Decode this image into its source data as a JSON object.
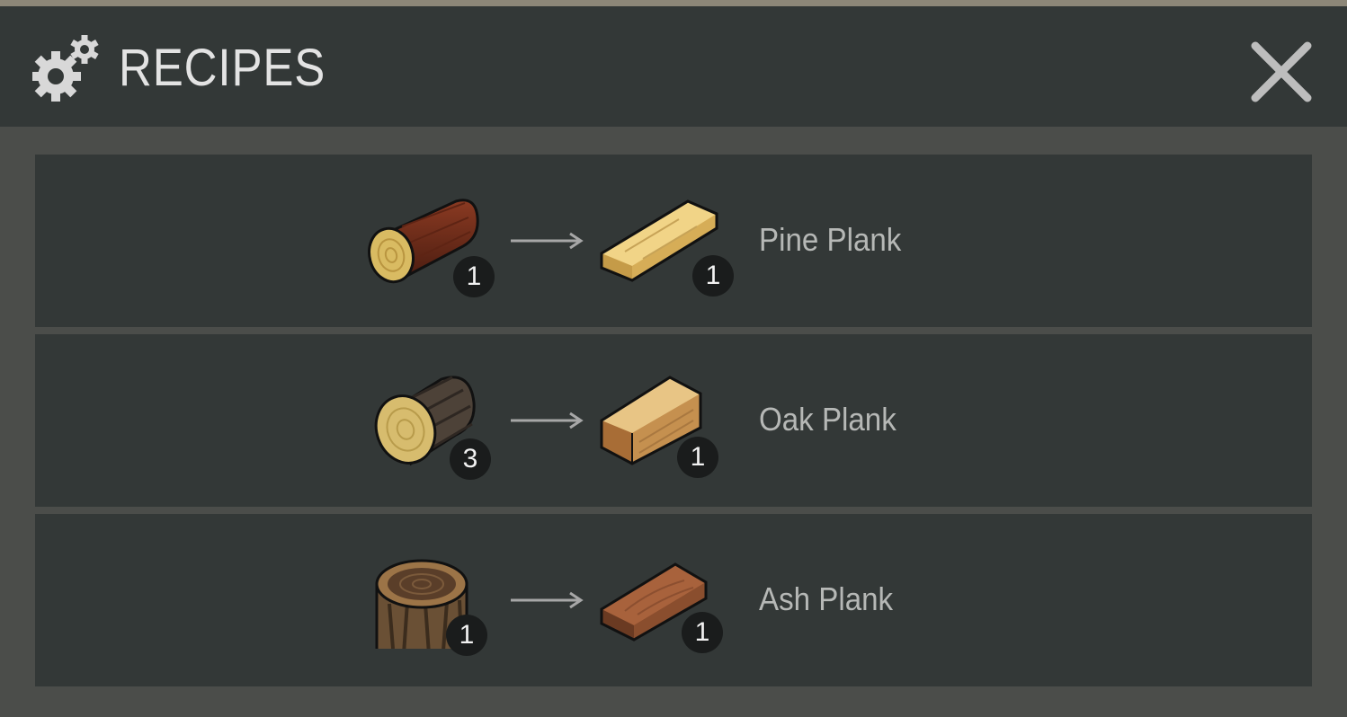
{
  "header": {
    "title": "RECIPES",
    "icon": "gears-icon",
    "close_icon": "close-icon"
  },
  "recipes": [
    {
      "input": "pine-log-icon",
      "input_qty": "1",
      "output": "pine-plank-icon",
      "output_qty": "1",
      "name": "Pine Plank"
    },
    {
      "input": "oak-log-icon",
      "input_qty": "3",
      "output": "oak-plank-icon",
      "output_qty": "1",
      "name": "Oak Plank"
    },
    {
      "input": "ash-stump-icon",
      "input_qty": "1",
      "output": "ash-plank-icon",
      "output_qty": "1",
      "name": "Ash Plank"
    }
  ],
  "colors": {
    "panel": "#333837",
    "background": "#4b4d4a",
    "title": "#e3e3e3",
    "text": "#b6b8b6"
  }
}
